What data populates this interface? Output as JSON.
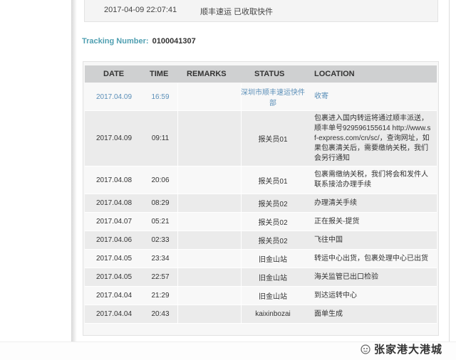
{
  "top_entry": {
    "datetime": "2017-04-09 22:07:41",
    "status": "顺丰速运 已收取快件"
  },
  "tracking": {
    "label": "Tracking Number:",
    "number": "0100041307"
  },
  "table": {
    "headers": {
      "date": "DATE",
      "time": "TIME",
      "remarks": "REMARKS",
      "status": "STATUS",
      "location": "LOCATION"
    },
    "rows": [
      {
        "date": "2017.04.09",
        "time": "16:59",
        "remarks": "",
        "status": "深圳市顺丰速运快件部",
        "location": "收寄"
      },
      {
        "date": "2017.04.09",
        "time": "09:11",
        "remarks": "",
        "status": "报关员01",
        "location": "包裹进入国内转运将通过顺丰派送，顺丰单号929596155614 http://www.sf-express.com/cn/sc/，查询网址，如果包裹清关后，需要缴纳关税，我们会另行通知"
      },
      {
        "date": "2017.04.08",
        "time": "20:06",
        "remarks": "",
        "status": "报关员01",
        "location": "包裹需缴纳关税，我们将会和发件人联系接洽办理手续"
      },
      {
        "date": "2017.04.08",
        "time": "08:29",
        "remarks": "",
        "status": "报关员02",
        "location": "办理清关手续"
      },
      {
        "date": "2017.04.07",
        "time": "05:21",
        "remarks": "",
        "status": "报关员02",
        "location": "正在报关-提货"
      },
      {
        "date": "2017.04.06",
        "time": "02:33",
        "remarks": "",
        "status": "报关员02",
        "location": "飞往中国"
      },
      {
        "date": "2017.04.05",
        "time": "23:34",
        "remarks": "",
        "status": "旧金山站",
        "location": "转运中心出货，包裹处理中心已出货"
      },
      {
        "date": "2017.04.05",
        "time": "22:57",
        "remarks": "",
        "status": "旧金山站",
        "location": "海关监管已出口检验"
      },
      {
        "date": "2017.04.04",
        "time": "21:29",
        "remarks": "",
        "status": "旧金山站",
        "location": "到达运转中心"
      },
      {
        "date": "2017.04.04",
        "time": "20:43",
        "remarks": "",
        "status": "kaixinbozai",
        "location": "面单生成"
      }
    ]
  },
  "watermark": {
    "text": "张家港大港城",
    "icon": "wechat-official-account-icon"
  }
}
